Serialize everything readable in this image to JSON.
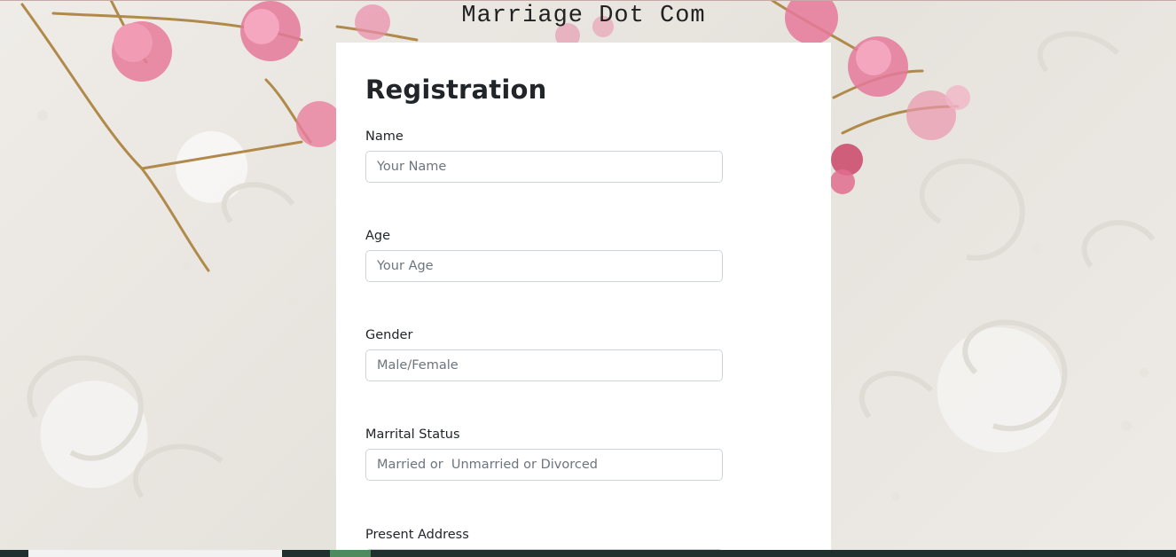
{
  "header": {
    "site_title": "Marriage Dot Com"
  },
  "form": {
    "title": "Registration",
    "fields": [
      {
        "label": "Name",
        "placeholder": "Your Name"
      },
      {
        "label": "Age",
        "placeholder": "Your Age"
      },
      {
        "label": "Gender",
        "placeholder": "Male/Female"
      },
      {
        "label": "Marrital Status",
        "placeholder": "Married or  Unmarried or Divorced"
      },
      {
        "label": "Present Address",
        "placeholder": ""
      }
    ]
  },
  "colors": {
    "background": "#ece9e4",
    "card": "#ffffff",
    "text": "#212529",
    "input_border": "#ced4da",
    "taskbar": "#20302e",
    "taskbar_active": "#4e8a5e"
  }
}
